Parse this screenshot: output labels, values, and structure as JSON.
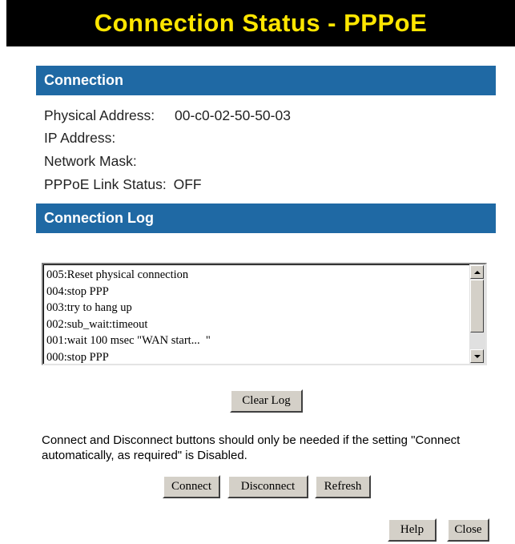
{
  "title": "Connection Status - PPPoE",
  "connection": {
    "header": "Connection",
    "rows": [
      {
        "label": "Physical Address:",
        "value": "00-c0-02-50-50-03"
      },
      {
        "label": "IP Address:",
        "value": ""
      },
      {
        "label": "Network Mask:",
        "value": ""
      },
      {
        "label": "PPPoE Link Status:",
        "value": "OFF"
      }
    ]
  },
  "log": {
    "header": "Connection Log",
    "lines": [
      "005:Reset physical connection",
      "004:stop PPP",
      "003:try to hang up",
      "002:sub_wait:timeout",
      "001:wait 100 msec \"WAN start...  \"",
      "000:stop PPP"
    ],
    "clear_label": "Clear Log"
  },
  "note": "Connect and Disconnect buttons should only be needed if the setting \"Connect automatically, as required\" is Disabled.",
  "buttons": {
    "connect": "Connect",
    "disconnect": "Disconnect",
    "refresh": "Refresh",
    "help": "Help",
    "close": "Close"
  },
  "colors": {
    "title_bg": "#000000",
    "title_text": "#ffe600",
    "section_bg": "#1f69a4"
  }
}
